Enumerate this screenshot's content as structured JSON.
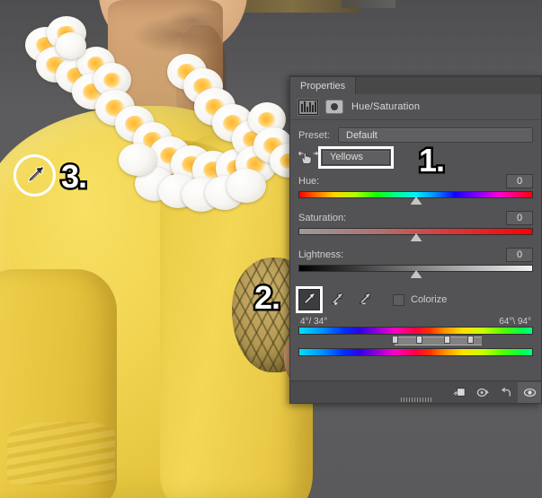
{
  "app": {
    "photo_description": "Man in yellow shirt wearing white plumeria flower lei holding a pineapple",
    "background_color": "#56565a"
  },
  "panel": {
    "tabs": [
      {
        "label": "Properties",
        "active": true
      },
      {
        "label": "",
        "active": false
      }
    ],
    "adjustment": {
      "title": "Hue/Saturation",
      "adjustment_icon": "hue-saturation-icon",
      "mask_icon": "layer-mask-icon"
    },
    "preset": {
      "label": "Preset:",
      "value": "Default"
    },
    "range": {
      "hand_icon": "on-image-adjust-hand-icon",
      "value": "Yellows",
      "focused": true
    },
    "sliders": [
      {
        "label": "Hue:",
        "value": "0",
        "thumb_percent": 50,
        "track": "hue"
      },
      {
        "label": "Saturation:",
        "value": "0",
        "thumb_percent": 50,
        "track": "sat"
      },
      {
        "label": "Lightness:",
        "value": "0",
        "thumb_percent": 50,
        "track": "lig"
      }
    ],
    "tools": {
      "eyedroppers": [
        {
          "name": "eyedropper-icon",
          "active": true,
          "mode": ""
        },
        {
          "name": "eyedropper-plus-icon",
          "active": false,
          "mode": "+"
        },
        {
          "name": "eyedropper-minus-icon",
          "active": false,
          "mode": "-"
        }
      ],
      "colorize": {
        "label": "Colorize",
        "checked": false
      }
    },
    "color_range": {
      "left_degrees": "4°/ 34°",
      "right_degrees": "64°\\ 94°",
      "handles": {
        "fall_off_start_percent": 41,
        "range_start_percent": 50,
        "range_end_percent": 63,
        "fall_off_end_percent": 72
      }
    },
    "bottom_bar": {
      "buttons": [
        {
          "name": "clip-to-layer-icon",
          "active": false
        },
        {
          "name": "view-previous-state-icon",
          "active": false
        },
        {
          "name": "reset-icon",
          "active": false
        },
        {
          "name": "toggle-visibility-eye-icon",
          "active": true
        }
      ],
      "resize_grip": "resize-grip"
    }
  },
  "callouts": [
    {
      "id": "1",
      "label": "1."
    },
    {
      "id": "2",
      "label": "2."
    },
    {
      "id": "3",
      "label": "3."
    }
  ],
  "cursor": {
    "name": "eyedropper-cursor",
    "highlight_ring": true
  }
}
